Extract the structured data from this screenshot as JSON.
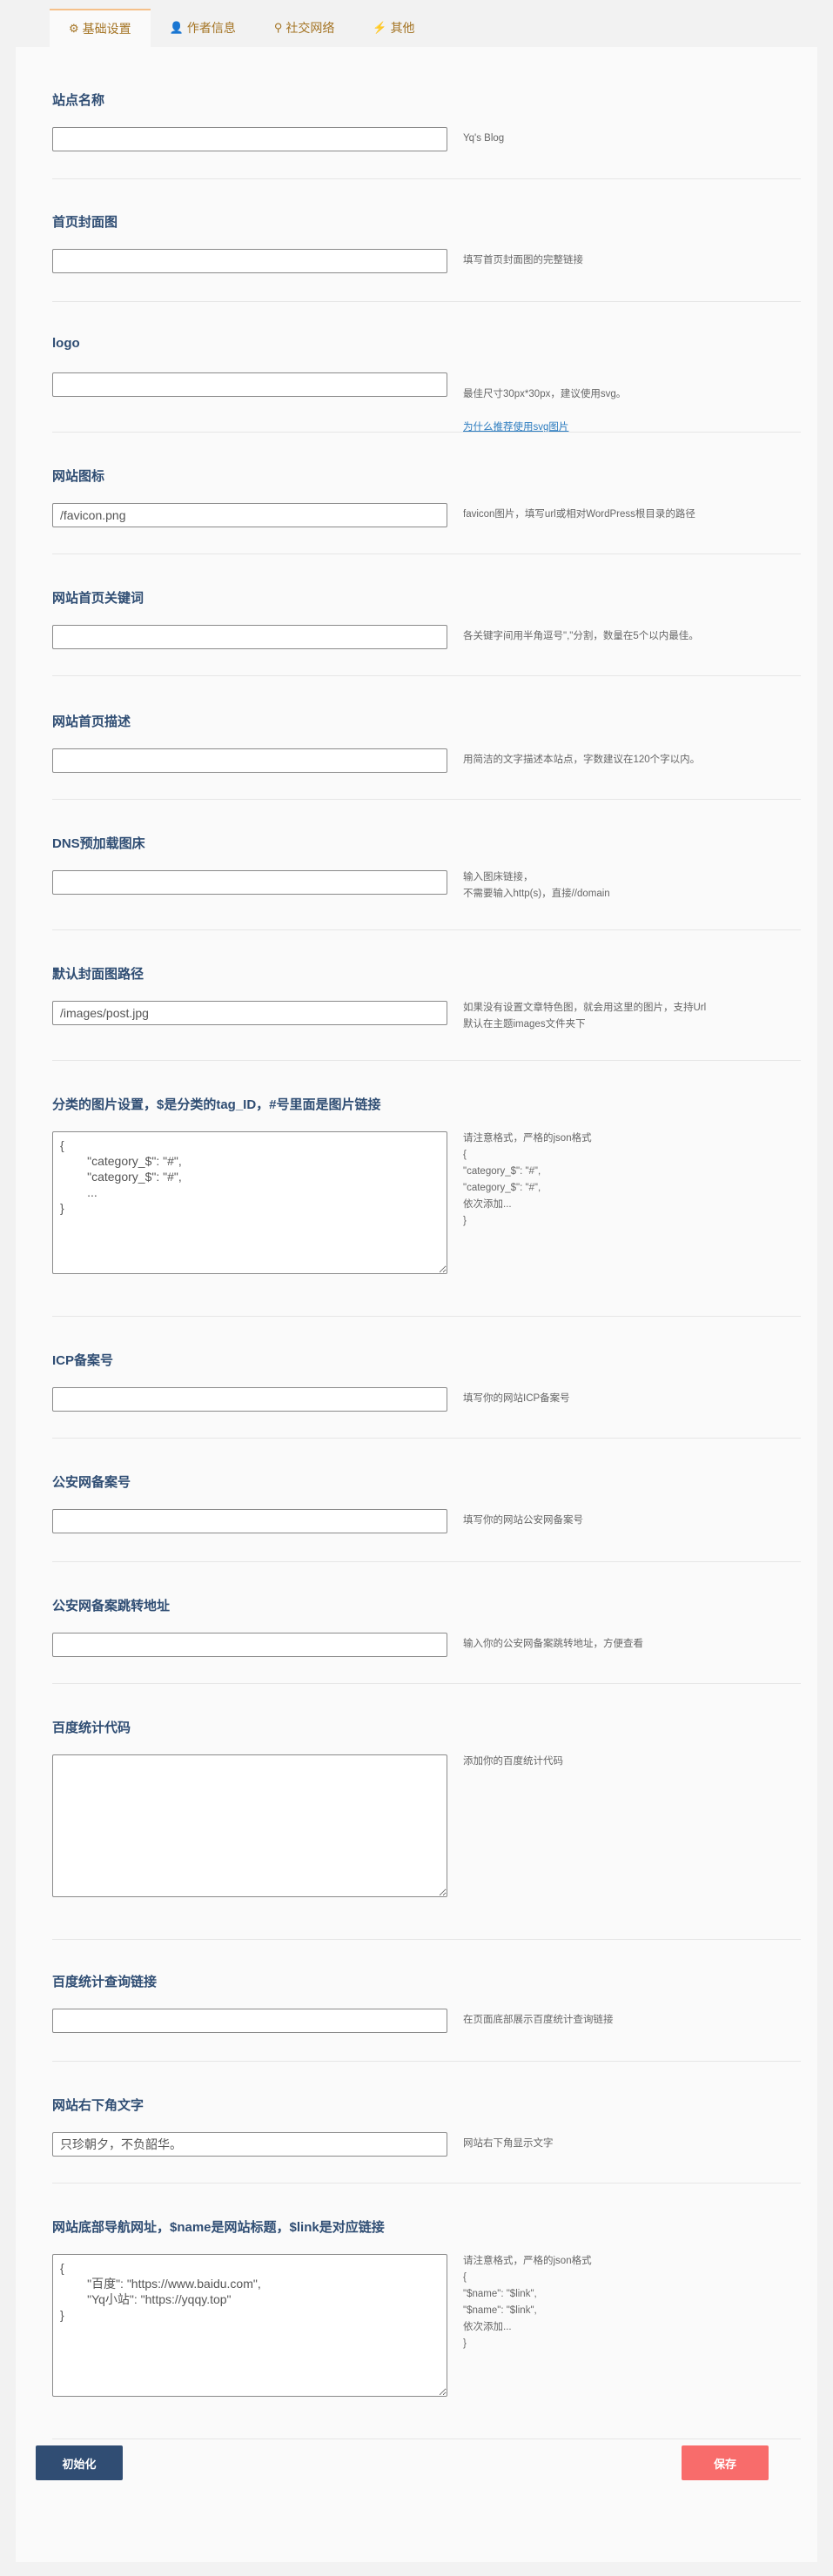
{
  "tabs": [
    {
      "icon": "gear-icon",
      "glyph": "⚙",
      "label": "基础设置"
    },
    {
      "icon": "user-icon",
      "glyph": "👤",
      "label": "作者信息"
    },
    {
      "icon": "share-icon",
      "glyph": "⚲",
      "label": "社交网络"
    },
    {
      "icon": "bolt-icon",
      "glyph": "⚡",
      "label": "其他"
    }
  ],
  "fields": [
    {
      "label": "站点名称",
      "value": "",
      "placeholder": "",
      "desc": "Yq's Blog"
    },
    {
      "label": "首页封面图",
      "value": "",
      "placeholder": "",
      "desc": "填写首页封面图的完整链接"
    },
    {
      "label": "logo",
      "value": "",
      "placeholder": "",
      "desc": "最佳尺寸30px*30px，建议使用svg。",
      "link": "为什么推荐使用svg图片"
    },
    {
      "label": "网站图标",
      "value": "/favicon.png",
      "placeholder": "",
      "desc": "favicon图片，填写url或相对WordPress根目录的路径"
    },
    {
      "label": "网站首页关键词",
      "value": "",
      "placeholder": "",
      "desc": "各关键字间用半角逗号\",\"分割，数量在5个以内最佳。"
    },
    {
      "label": "网站首页描述",
      "value": "",
      "placeholder": "",
      "desc": "用简洁的文字描述本站点，字数建议在120个字以内。"
    },
    {
      "label": "DNS预加载图床",
      "value": "",
      "placeholder": "",
      "desc": "输入图床链接，\n不需要输入http(s)，直接//domain"
    },
    {
      "label": "默认封面图路径",
      "value": "/images/post.jpg",
      "placeholder": "",
      "desc": "如果没有设置文章特色图，就会用这里的图片，支持Url\n默认在主题images文件夹下"
    },
    {
      "label": "分类的图片设置，$是分类的tag_ID，#号里面是图片链接",
      "value": "{\n        \"category_$\": \"#\",\n        \"category_$\": \"#\",\n        ...\n}",
      "placeholder": "",
      "desc": "请注意格式，严格的json格式\n{\n\"category_$\": \"#\",\n\"category_$\": \"#\",\n依次添加...\n}"
    },
    {
      "label": "ICP备案号",
      "value": "",
      "placeholder": "",
      "desc": "填写你的网站ICP备案号"
    },
    {
      "label": "公安网备案号",
      "value": "",
      "placeholder": "",
      "desc": "填写你的网站公安网备案号"
    },
    {
      "label": "公安网备案跳转地址",
      "value": "",
      "placeholder": "",
      "desc": "输入你的公安网备案跳转地址，方便查看"
    },
    {
      "label": "百度统计代码",
      "value": "",
      "placeholder": "",
      "desc": "添加你的百度统计代码"
    },
    {
      "label": "百度统计查询链接",
      "value": "",
      "placeholder": "",
      "desc": "在页面底部展示百度统计查询链接"
    },
    {
      "label": "网站右下角文字",
      "value": "只珍朝夕，不负韶华。",
      "placeholder": "",
      "desc": "网站右下角显示文字"
    },
    {
      "label": "网站底部导航网址，$name是网站标题，$link是对应链接",
      "value": "{\n        \"百度\": \"https://www.baidu.com\",\n        \"Yq小站\": \"https://yqqy.top\"\n}",
      "placeholder": "",
      "desc": "请注意格式，严格的json格式\n{\n\"$name\": \"$link\",\n\"$name\": \"$link\",\n依次添加...\n}"
    }
  ],
  "buttons": {
    "init": "初始化",
    "save": "保存"
  },
  "colors": {
    "accent": "#a47424",
    "title": "#2f4d73",
    "init": "#304d73",
    "save": "#f86c6b"
  }
}
